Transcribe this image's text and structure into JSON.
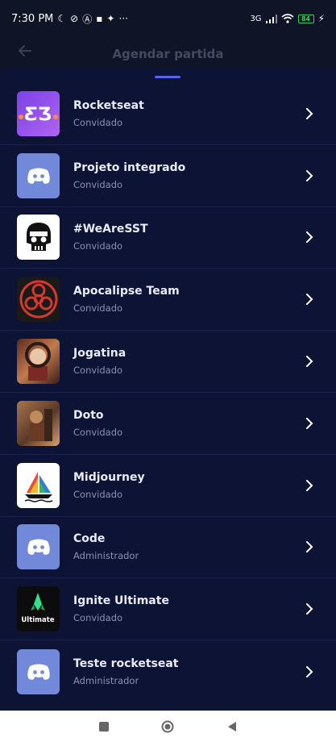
{
  "status": {
    "time": "7:30 PM",
    "icons_left": [
      "moon-icon",
      "no-wifi-data-icon",
      "a-icon",
      "chat-icon",
      "sparkle-icon"
    ],
    "more": "···",
    "network": "3G",
    "battery": "84"
  },
  "header": {
    "back_icon": "arrow-left-icon",
    "title": "Agendar partida"
  },
  "guilds": [
    {
      "name": "Rocketseat",
      "role": "Convidado",
      "avatar": "rocketseat"
    },
    {
      "name": "Projeto integrado",
      "role": "Convidado",
      "avatar": "discord"
    },
    {
      "name": "#WeAreSST",
      "role": "Convidado",
      "avatar": "skull"
    },
    {
      "name": "Apocalipse Team",
      "role": "Convidado",
      "avatar": "biohazard"
    },
    {
      "name": "Jogatina",
      "role": "Convidado",
      "avatar": "photo"
    },
    {
      "name": "Doto",
      "role": "Convidado",
      "avatar": "photo"
    },
    {
      "name": "Midjourney",
      "role": "Convidado",
      "avatar": "boat"
    },
    {
      "name": "Code",
      "role": "Administrador",
      "avatar": "discord"
    },
    {
      "name": "Ignite Ultimate",
      "role": "Convidado",
      "avatar": "ultimate",
      "avatar_text": "Ultimate"
    },
    {
      "name": "Teste rocketseat",
      "role": "Administrador",
      "avatar": "discord"
    }
  ],
  "navbar": {
    "buttons": [
      "recents-square-icon",
      "home-circle-icon",
      "back-triangle-icon"
    ]
  }
}
